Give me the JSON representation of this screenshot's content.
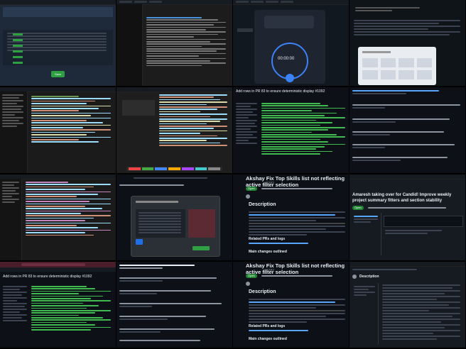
{
  "tiles": [
    {
      "id": "admin-table",
      "kind": "table",
      "title": "",
      "button": "Save"
    },
    {
      "id": "code-editor-dark",
      "kind": "editor"
    },
    {
      "id": "timer-dialog",
      "kind": "timer",
      "time": "00:00:00"
    },
    {
      "id": "chat-calendar",
      "kind": "dialog"
    },
    {
      "id": "file-tree-editor",
      "kind": "editor"
    },
    {
      "id": "split-editor",
      "kind": "editor"
    },
    {
      "id": "pr-diff",
      "kind": "diff",
      "title": "Add rows in PR 83 to ensure deterministic display #1092"
    },
    {
      "id": "comment-thread",
      "kind": "thread"
    },
    {
      "id": "git-editor",
      "kind": "editor"
    },
    {
      "id": "issue-modal",
      "kind": "modal"
    },
    {
      "id": "issue-description-1",
      "kind": "issue",
      "title": "Akshay Fix Top Skills list not reflecting active filter selection",
      "number": "#3282",
      "status": "Open",
      "heading": "Description",
      "subheading": "Related PRs and logs",
      "footer": "Main changes outlined"
    },
    {
      "id": "project-summary",
      "kind": "issue",
      "title": "Amaresh taking over for Candid! Improve weekly project summary fitters and section stability",
      "number": "#3212",
      "status": "Open"
    },
    {
      "id": "browser-pr-diff",
      "kind": "diff",
      "title": "Add rows in PR 83 to ensure deterministic display #1092"
    },
    {
      "id": "comment-thread-2",
      "kind": "thread"
    },
    {
      "id": "issue-description-2",
      "kind": "issue",
      "title": "Akshay Fix Top Skills list not reflecting active filter selection",
      "number": "#3282",
      "status": "Open",
      "heading": "Description",
      "subheading": "Related PRs and logs",
      "footer": "Main changes outlined"
    },
    {
      "id": "doc-page",
      "kind": "document",
      "title": "Description"
    }
  ],
  "colors": {
    "bg": "#0d1117",
    "green": "#238636",
    "blue": "#1f6feb",
    "accent": "#58a6ff"
  }
}
